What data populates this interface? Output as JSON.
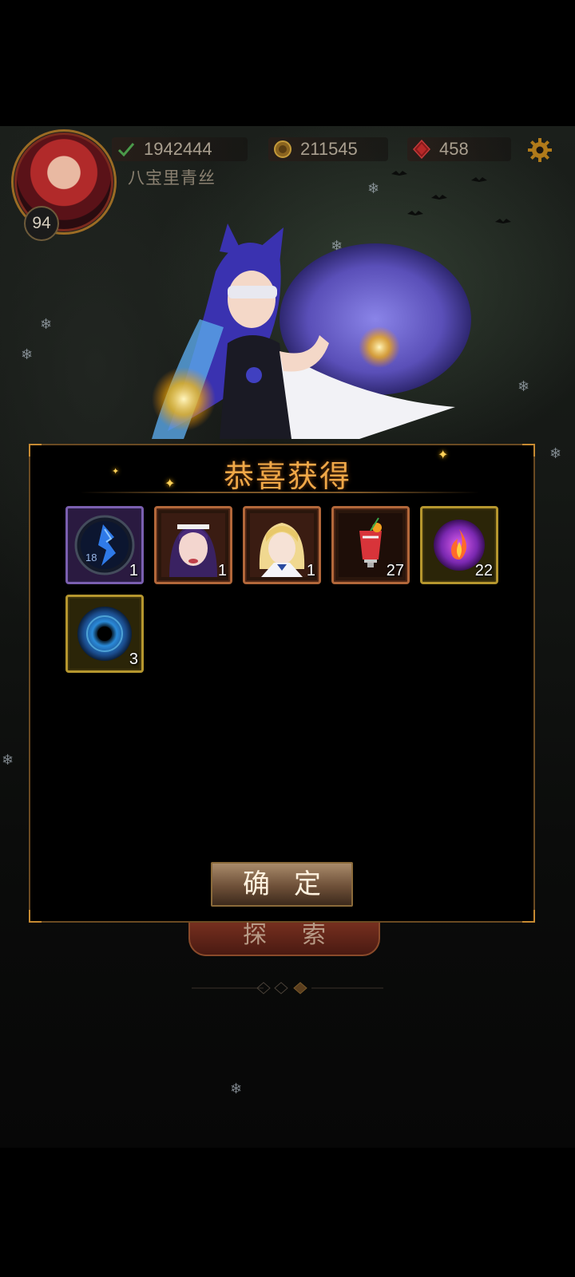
{
  "player": {
    "level": "94",
    "name": "八宝里青丝"
  },
  "resources": {
    "stamina": "1942444",
    "gold": "211545",
    "gems": "458"
  },
  "icons": {
    "stamina": "checkmark-icon",
    "gold": "gold-coin-icon",
    "gems": "red-gem-icon",
    "settings": "gear-icon"
  },
  "background_button": {
    "label": "探索"
  },
  "reward_dialog": {
    "title": "恭喜获得",
    "confirm_label": "确定",
    "items": [
      {
        "icon": "blue-crystal-orb-icon",
        "rarity": "purple",
        "count": "1",
        "inner_label": "18"
      },
      {
        "icon": "character-portrait-purple-hair-icon",
        "rarity": "orange",
        "count": "1"
      },
      {
        "icon": "character-portrait-blonde-icon",
        "rarity": "orange",
        "count": "1"
      },
      {
        "icon": "red-drink-icon",
        "rarity": "orange",
        "count": "27"
      },
      {
        "icon": "purple-fire-orb-icon",
        "rarity": "gold",
        "count": "22"
      },
      {
        "icon": "blue-vortex-orb-icon",
        "rarity": "gold",
        "count": "3"
      }
    ]
  },
  "colors": {
    "title": "#f0a848",
    "rarity_purple": "#7a5fb0",
    "rarity_orange": "#b2673a",
    "rarity_gold": "#b5962e"
  }
}
